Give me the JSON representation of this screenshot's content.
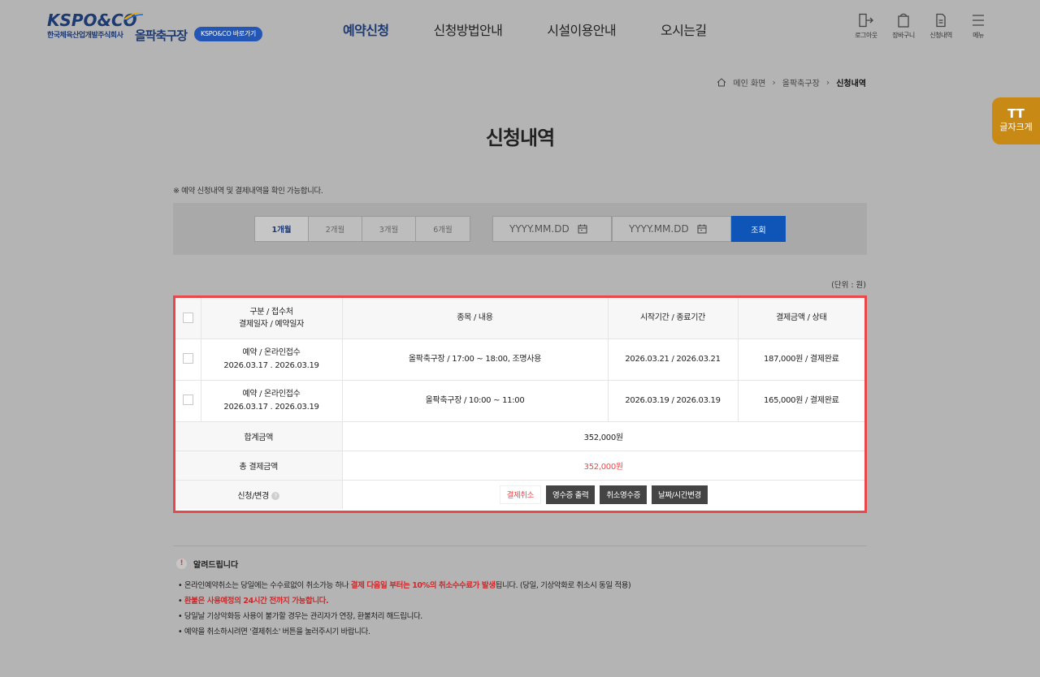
{
  "header": {
    "logo_text": "KSPO&CO",
    "logo_subtitle": "한국체육산업개발주식회사",
    "site_name": "올팍축구장",
    "site_link": "KSPO&CO 바로가기",
    "nav": [
      {
        "label": "예약신청",
        "active": true
      },
      {
        "label": "신청방법안내",
        "active": false
      },
      {
        "label": "시설이용안내",
        "active": false
      },
      {
        "label": "오시는길",
        "active": false
      }
    ],
    "utils": [
      {
        "icon": "logout-icon",
        "label": "로그아웃"
      },
      {
        "icon": "shopping-bag-icon",
        "label": "장바구니"
      },
      {
        "icon": "document-icon",
        "label": "신청내역"
      },
      {
        "icon": "hamburger-menu-icon",
        "label": "메뉴"
      }
    ]
  },
  "breadcrumb": {
    "home": "메인 화면",
    "middle": "올팍축구장",
    "current": "신청내역"
  },
  "font_size_button": {
    "icon": "TT",
    "label": "글자크게"
  },
  "page_title": "신청내역",
  "top_notice": "※ 예약 신청내역 및 결제내역을 확인 가능합니다.",
  "search": {
    "periods": [
      {
        "label": "1개월",
        "active": true
      },
      {
        "label": "2개월",
        "active": false
      },
      {
        "label": "3개월",
        "active": false
      },
      {
        "label": "6개월",
        "active": false
      }
    ],
    "date_from_placeholder": "YYYY.MM.DD",
    "date_to_placeholder": "YYYY.MM.DD",
    "search_button": "조회"
  },
  "unit": "(단위 : 원)",
  "table": {
    "headers": {
      "col1_line1": "구분 / 접수처",
      "col1_line2": "결제일자 / 예약일자",
      "col2": "종목 / 내용",
      "col3": "시작기간 / 종료기간",
      "col4": "결제금액 / 상태"
    },
    "rows": [
      {
        "type": "예약 / 온라인접수",
        "dates": "2026.03.17 . 2026.03.19",
        "content": "올팍축구장 / 17:00 ~ 18:00, 조명사용",
        "period": "2026.03.21 /  2026.03.21",
        "amount": "187,000원 / 결제완료"
      },
      {
        "type": "예약 / 온라인접수",
        "dates": "2026.03.17 . 2026.03.19",
        "content": "올팍축구장 / 10:00 ~ 11:00",
        "period": "2026.03.19 /  2026.03.19",
        "amount": "165,000원 / 결제완료"
      }
    ],
    "sum_label": "합계금액",
    "sum_value": "352,000원",
    "total_label": "총 결제금액",
    "total_value": "352,000원",
    "action_label": "신청/변경",
    "help_icon": "?",
    "actions": {
      "cancel_payment": "결제취소",
      "print_receipt": "영수증 출력",
      "cancel_receipt": "취소영수증",
      "change_datetime": "날짜/시간변경"
    }
  },
  "bottom_notice": {
    "title": "알려드립니다",
    "warn_glyph": "!",
    "line1_pre": "온라인예약취소는 당일에는 수수료없이 취소가능 하나 ",
    "line1_red": "결제 다음일 부터는 10%의 취소수수료가 발생",
    "line1_post": "됩니다. (당일, 기상악화로 취소시 동일 적용)",
    "line2_red": "환불은 사용예정의 24시간 전까지 가능합니다.",
    "line3": "당일날 기상악화등 사용이 불가할 경우는 관리자가 연장, 환불처리 해드립니다.",
    "line4": "예약을 취소하시려면 '결제취소' 버튼을 눌러주시기 바랍니다."
  },
  "colors": {
    "brand_navy": "#1e3a72",
    "primary_blue": "#0e55b7",
    "highlight_red": "#e8484a",
    "font_button_orange": "#c88a14"
  }
}
